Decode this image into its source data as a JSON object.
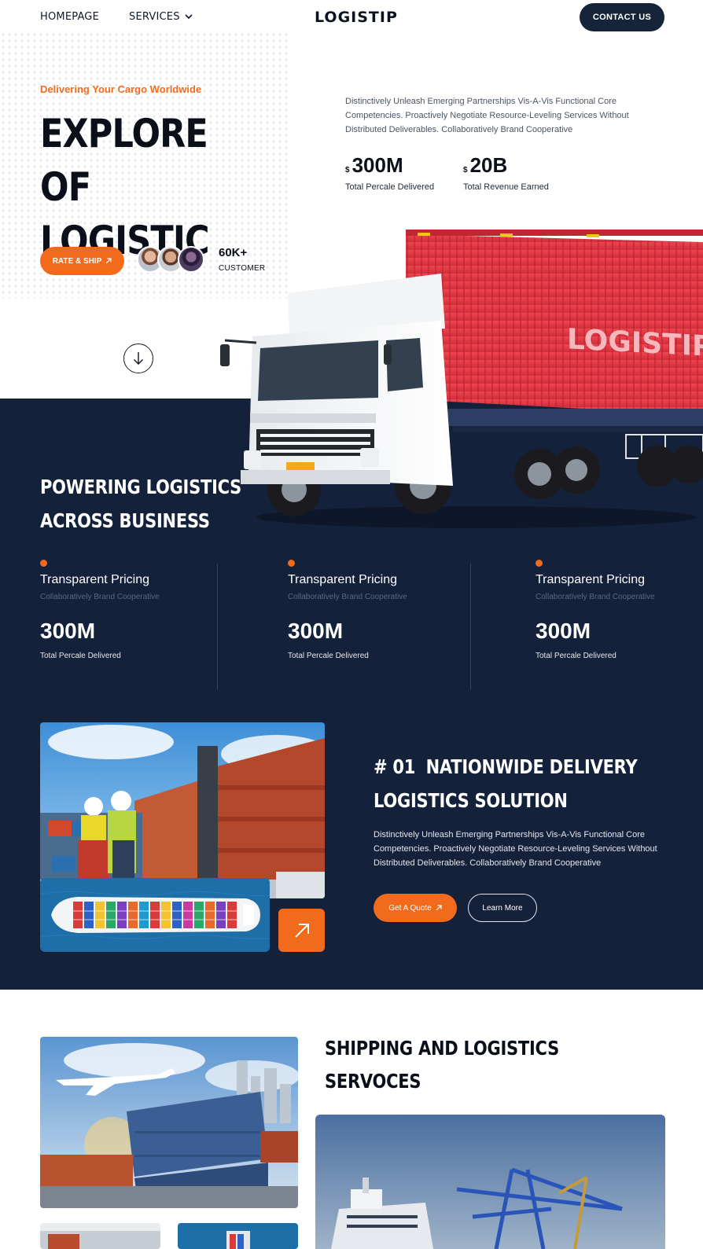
{
  "header": {
    "nav": [
      {
        "label": "HOMEPAGE"
      },
      {
        "label": "SERVICES"
      }
    ],
    "logo": "LOGISTIP",
    "contact_label": "CONTACT US"
  },
  "hero": {
    "kicker": "Delivering Your Cargo Worldwide",
    "title_line1": "EXPLORE OF",
    "title_line2": "LOGISTIC",
    "description": "Distinctively Unleash Emerging Partnerships Vis-A-Vis Functional Core Competencies. Proactively Negotiate Resource-Leveling Services Without Distributed Deliverables. Collaboratively Brand Cooperative",
    "stats": [
      {
        "currency": "$",
        "value": "300M",
        "label": "Total Percale Delivered"
      },
      {
        "currency": "$",
        "value": "20B",
        "label": "Total Revenue Earned"
      }
    ],
    "cta_label": "RATE & SHIP",
    "customers_count": "60K+",
    "customers_label": "CUSTOMER",
    "truck_text": "LOGISTIP"
  },
  "powering": {
    "title_line1": "POWERING LOGISTICS",
    "title_line2": "ACROSS BUSINESS",
    "features": [
      {
        "title": "Transparent Pricing",
        "subtitle": "Collaboratively Brand Cooperative",
        "value": "300M",
        "label": "Total Percale Delivered"
      },
      {
        "title": "Transparent Pricing",
        "subtitle": "Collaboratively Brand Cooperative",
        "value": "300M",
        "label": "Total Percale Delivered"
      },
      {
        "title": "Transparent Pricing",
        "subtitle": "Collaboratively Brand Cooperative",
        "value": "300M",
        "label": "Total Percale Delivered"
      }
    ]
  },
  "nationwide": {
    "number": "# 01",
    "title_line1": "NATIONWIDE DELIVERY",
    "title_line2": "LOGISTICS SOLUTION",
    "description": "Distinctively Unleash Emerging Partnerships Vis-A-Vis Functional Core Competencies. Proactively Negotiate Resource-Leveling Services Without Distributed Deliverables. Collaboratively Brand Cooperative",
    "quote_label": "Get A Quote",
    "more_label": "Learn More"
  },
  "shipping": {
    "title_line1": "SHIPPING AND LOGISTICS",
    "title_line2": "SERVOCES"
  },
  "colors": {
    "accent": "#f26b1d",
    "navy": "#14213a",
    "contact_bg": "#16243a"
  }
}
